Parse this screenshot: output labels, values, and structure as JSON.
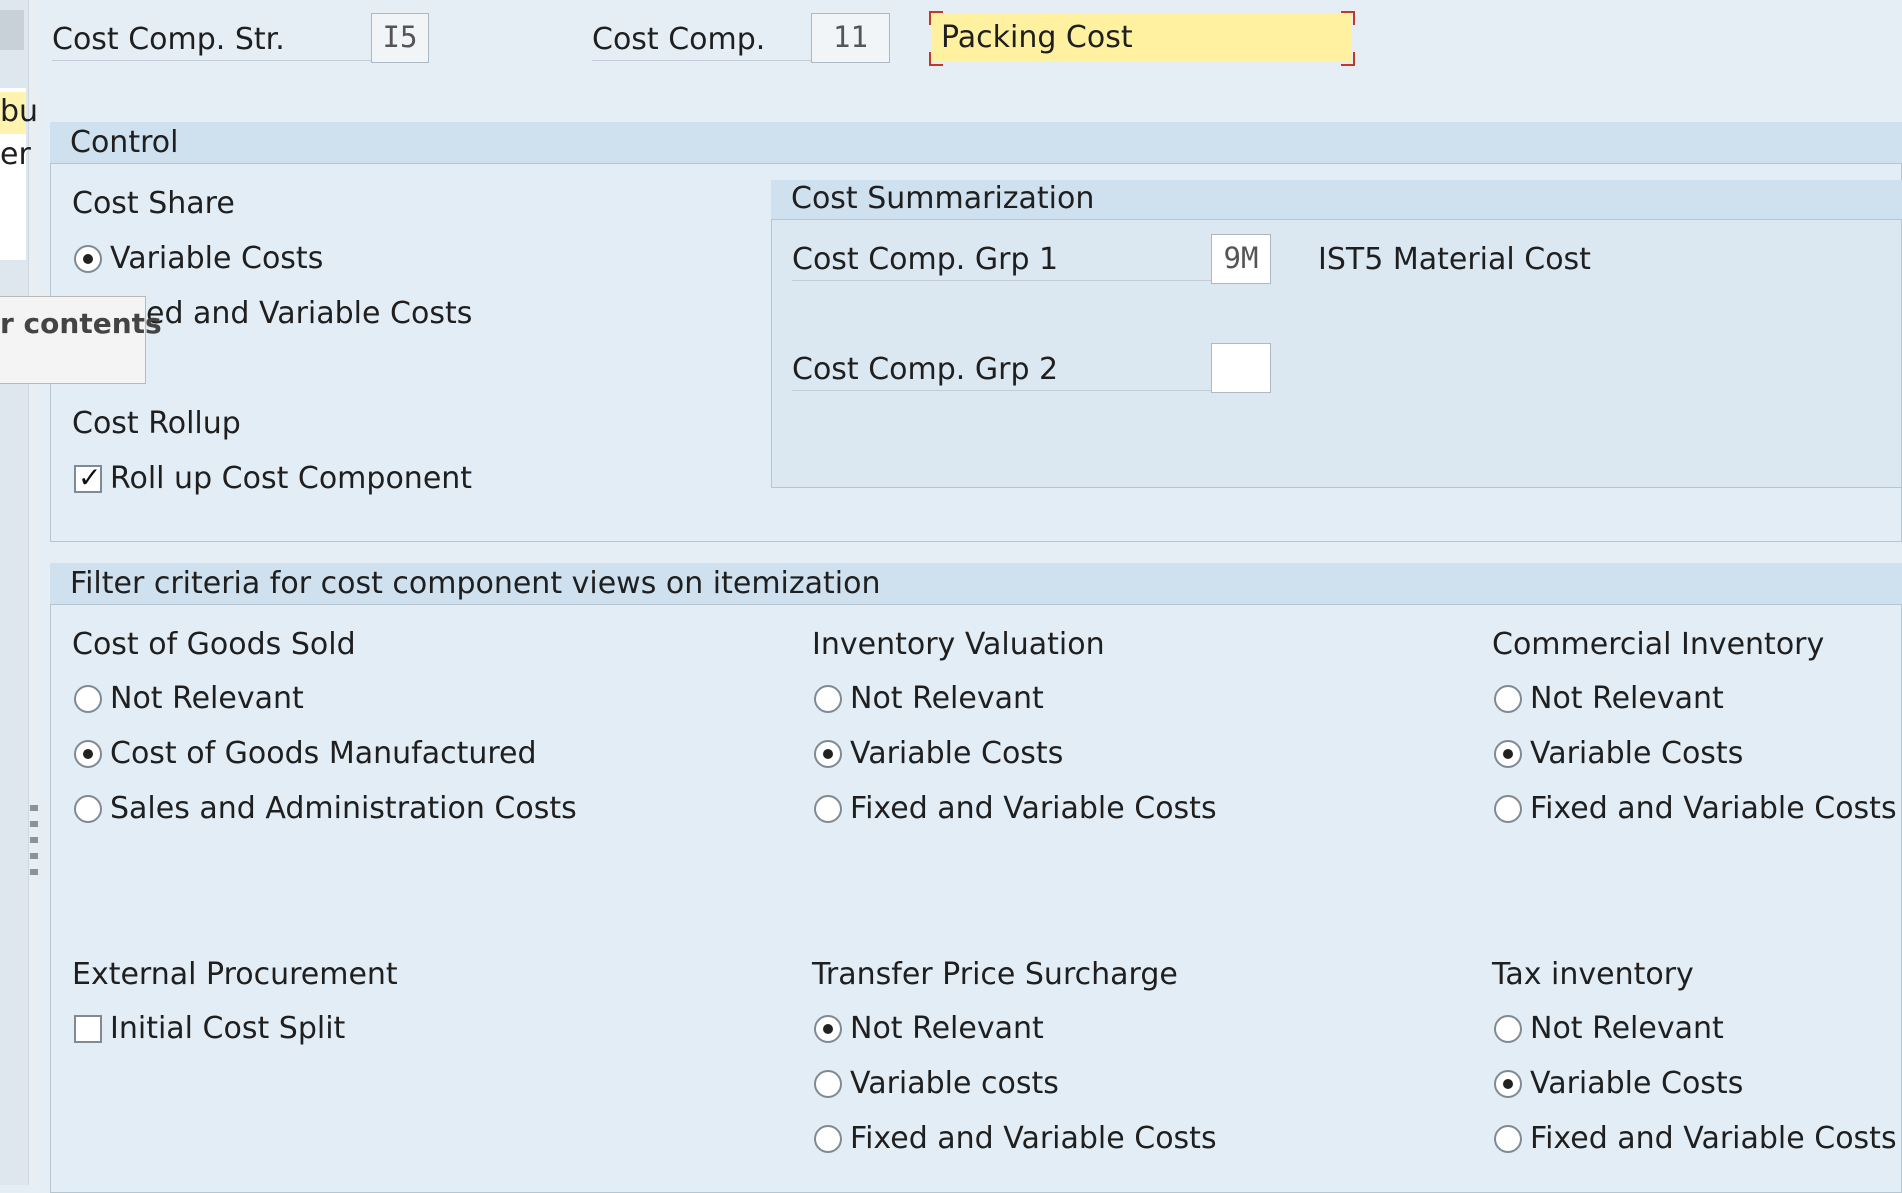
{
  "header": {
    "cost_comp_str_label": "Cost Comp. Str.",
    "cost_comp_str_value": "I5",
    "cost_comp_label": "Cost Comp.",
    "cost_comp_value": "11",
    "description_value": "Packing Cost"
  },
  "left_panel": {
    "cut_text_1": "bu",
    "cut_text_2": "er",
    "tooltip_text": "r contents"
  },
  "control": {
    "title": "Control",
    "cost_share": {
      "label": "Cost Share",
      "option_variable": "Variable Costs",
      "option_fixed_variable_visible": "ed and Variable Costs",
      "selected": "Variable Costs"
    },
    "cost_rollup": {
      "label": "Cost Rollup",
      "checkbox_label": "Roll up Cost Component",
      "checked": true
    },
    "cost_summarization": {
      "title": "Cost Summarization",
      "grp1_label": "Cost Comp. Grp 1",
      "grp1_value": "9M",
      "grp1_description": "IST5 Material Cost",
      "grp2_label": "Cost Comp. Grp 2",
      "grp2_value": ""
    }
  },
  "filter": {
    "title": "Filter criteria for cost component views on itemization",
    "cogs": {
      "label": "Cost of Goods Sold",
      "options": [
        "Not Relevant",
        "Cost of Goods Manufactured",
        "Sales and Administration Costs"
      ],
      "selected_index": 1
    },
    "inventory_valuation": {
      "label": "Inventory Valuation",
      "options": [
        "Not Relevant",
        "Variable Costs",
        "Fixed and Variable Costs"
      ],
      "selected_index": 1
    },
    "commercial_inventory": {
      "label": "Commercial Inventory",
      "options": [
        "Not Relevant",
        "Variable Costs",
        "Fixed and Variable Costs"
      ],
      "selected_index": 1
    },
    "external_procurement": {
      "label": "External Procurement",
      "checkbox_label": "Initial Cost Split",
      "checked": false
    },
    "transfer_price": {
      "label": "Transfer Price Surcharge",
      "options": [
        "Not Relevant",
        "Variable costs",
        "Fixed and Variable Costs"
      ],
      "selected_index": 0
    },
    "tax_inventory": {
      "label": "Tax inventory",
      "options": [
        "Not Relevant",
        "Variable Costs",
        "Fixed and Variable Costs"
      ],
      "selected_index": 1
    }
  }
}
